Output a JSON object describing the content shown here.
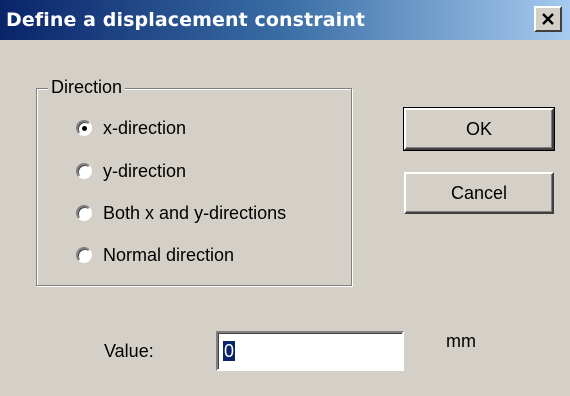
{
  "window": {
    "title": "Define a displacement constraint",
    "close_icon": "close-icon"
  },
  "direction_group": {
    "label": "Direction",
    "selected": "x-direction",
    "options": [
      {
        "label": "x-direction",
        "checked": true
      },
      {
        "label": "y-direction",
        "checked": false
      },
      {
        "label": "Both x and y-directions",
        "checked": false
      },
      {
        "label": "Normal direction",
        "checked": false
      }
    ]
  },
  "buttons": {
    "ok_label": "OK",
    "cancel_label": "Cancel"
  },
  "value": {
    "label": "Value:",
    "input_value": "0",
    "unit": "mm"
  }
}
